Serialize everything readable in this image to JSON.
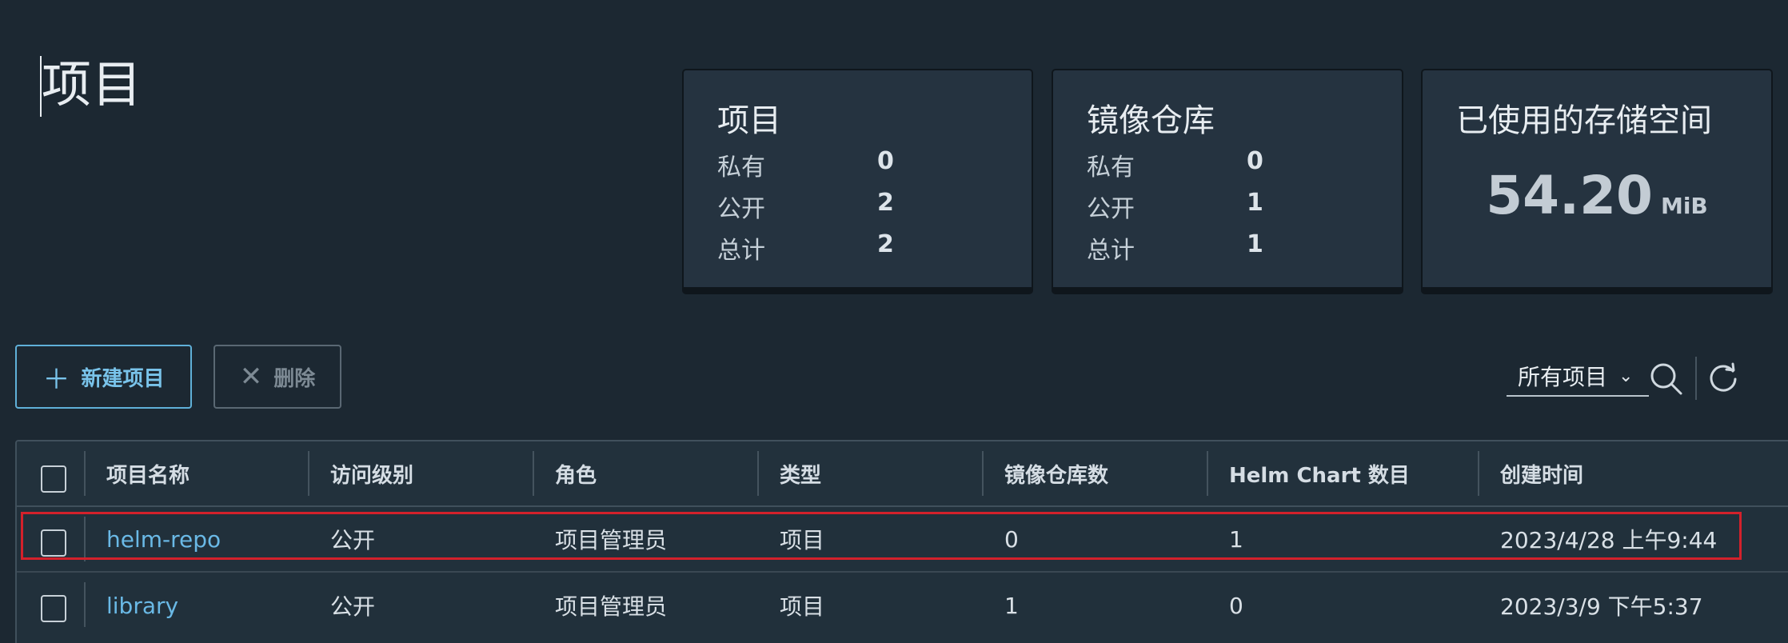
{
  "page": {
    "title": "项目"
  },
  "cards": {
    "projects": {
      "title": "项目",
      "rows": [
        {
          "label": "私有",
          "value": "0"
        },
        {
          "label": "公开",
          "value": "2"
        },
        {
          "label": "总计",
          "value": "2"
        }
      ]
    },
    "repositories": {
      "title": "镜像仓库",
      "rows": [
        {
          "label": "私有",
          "value": "0"
        },
        {
          "label": "公开",
          "value": "1"
        },
        {
          "label": "总计",
          "value": "1"
        }
      ]
    },
    "storage": {
      "title": "已使用的存储空间",
      "value": "54.20",
      "unit": "MiB"
    }
  },
  "actions": {
    "new_project": {
      "icon": "plus-icon",
      "label": "新建项目"
    },
    "delete": {
      "icon": "close-icon",
      "label": "删除"
    }
  },
  "toolbar": {
    "filter_selected": "所有项目",
    "icons": [
      "chevron-down-icon",
      "search-icon",
      "refresh-icon"
    ]
  },
  "table": {
    "columns": [
      "项目名称",
      "访问级别",
      "角色",
      "类型",
      "镜像仓库数",
      "Helm Chart 数目",
      "创建时间"
    ],
    "rows": [
      {
        "name": "helm-repo",
        "access": "公开",
        "role": "项目管理员",
        "type": "项目",
        "repo_count": "0",
        "chart_count": "1",
        "created": "2023/4/28 上午9:44"
      },
      {
        "name": "library",
        "access": "公开",
        "role": "项目管理员",
        "type": "项目",
        "repo_count": "1",
        "chart_count": "0",
        "created": "2023/3/9 下午5:37"
      }
    ]
  },
  "colors": {
    "background": "#1c2832",
    "card": "#253340",
    "accent": "#6ab9e6",
    "highlight": "#d3212b"
  }
}
